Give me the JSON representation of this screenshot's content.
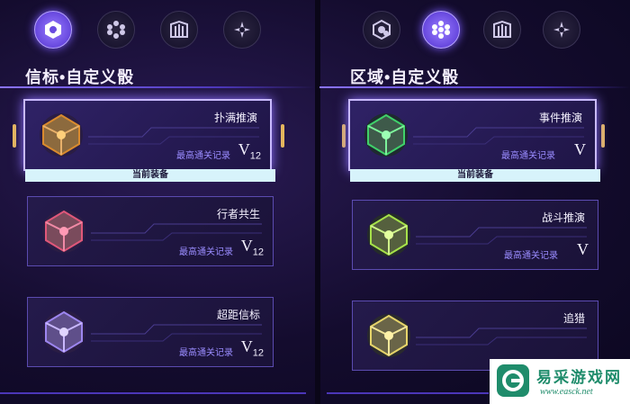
{
  "left": {
    "title": "信标•自定义骰",
    "tabs": [
      "tab-icon-a",
      "tab-icon-b",
      "tab-icon-c",
      "tab-icon-d"
    ],
    "active_tab": 0,
    "equip_label": "当前装备",
    "cards": [
      {
        "name": "扑满推演",
        "record_label": "最高通关记录",
        "record_v": "V",
        "record_sub": "12",
        "die_color": "#d98a2e",
        "equipped": true
      },
      {
        "name": "行者共生",
        "record_label": "最高通关记录",
        "record_v": "V",
        "record_sub": "12",
        "die_color": "#e0577a",
        "equipped": false
      },
      {
        "name": "超距信标",
        "record_label": "最高通关记录",
        "record_v": "V",
        "record_sub": "12",
        "die_color": "#9d86f0",
        "equipped": false
      }
    ]
  },
  "right": {
    "title": "区域•自定义骰",
    "tabs": [
      "tab-icon-a",
      "tab-icon-b",
      "tab-icon-c",
      "tab-icon-d"
    ],
    "active_tab": 1,
    "equip_label": "当前装备",
    "cards": [
      {
        "name": "事件推演",
        "record_label": "最高通关记录",
        "record_v": "V",
        "record_sub": "",
        "die_color": "#3fd16a",
        "equipped": true
      },
      {
        "name": "战斗推演",
        "record_label": "最高通关记录",
        "record_v": "V",
        "record_sub": "",
        "die_color": "#a6e14a",
        "equipped": false
      },
      {
        "name": "追猎",
        "record_label": "",
        "record_v": "",
        "record_sub": "",
        "die_color": "#e6d46a",
        "equipped": false
      }
    ]
  },
  "watermark": {
    "name": "易采游戏网",
    "url": "www.easck.net"
  }
}
